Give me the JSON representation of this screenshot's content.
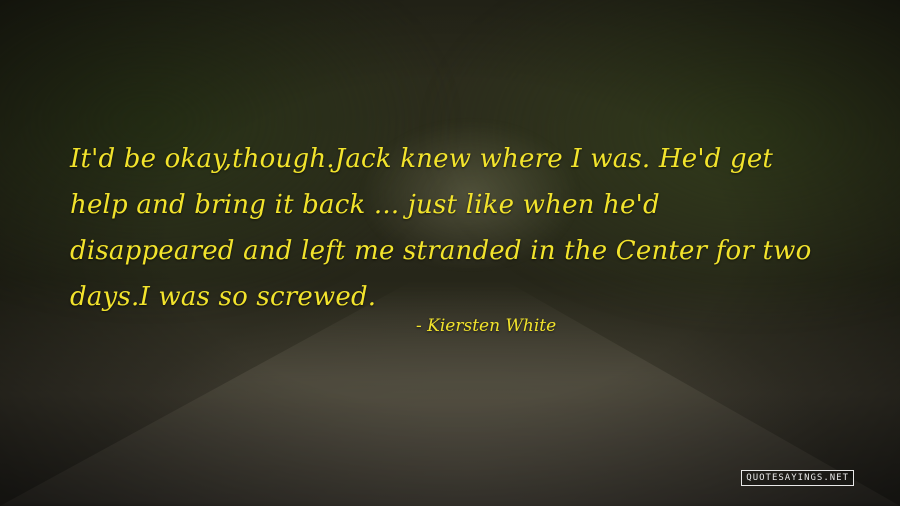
{
  "quote": {
    "lines": [
      "It'd be okay,though.Jack knew where I was. He'd get",
      "help and bring it back ... just like when he'd",
      "disappeared and left me stranded in the Center for two",
      "days.I was so screwed."
    ],
    "author": "- Kiersten White"
  },
  "watermark": "QUOTESAYINGS.NET",
  "colors": {
    "text": "#f2e32c",
    "background": "#2a2a1c",
    "watermark": "#e8e8e8"
  }
}
